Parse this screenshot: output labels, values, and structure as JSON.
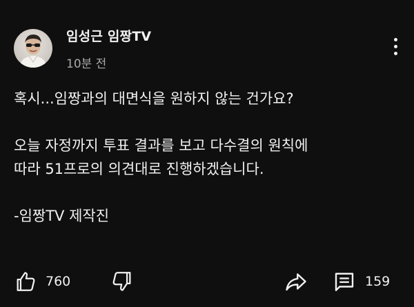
{
  "post": {
    "author": "임성근 임짱TV",
    "time": "10분 전",
    "lines": [
      "혹시...임짱과의 대면식을 원하지 않는 건가요?",
      "",
      "오늘 자정까지 투표 결과를 보고 다수결의 원칙에",
      "따라 51프로의 의견대로 진행하겠습니다.",
      "",
      "-임짱TV 제작진"
    ]
  },
  "actions": {
    "like_count": "760",
    "comment_count": "159"
  },
  "icons": {
    "avatar": "avatar-photo",
    "menu": "more-vert-icon",
    "like": "thumbs-up-icon",
    "dislike": "thumbs-down-icon",
    "share": "share-arrow-icon",
    "comment": "comment-icon"
  },
  "colors": {
    "background": "#0f0f0f",
    "text": "#f1f1f1",
    "secondary_text": "#aaaaaa"
  }
}
